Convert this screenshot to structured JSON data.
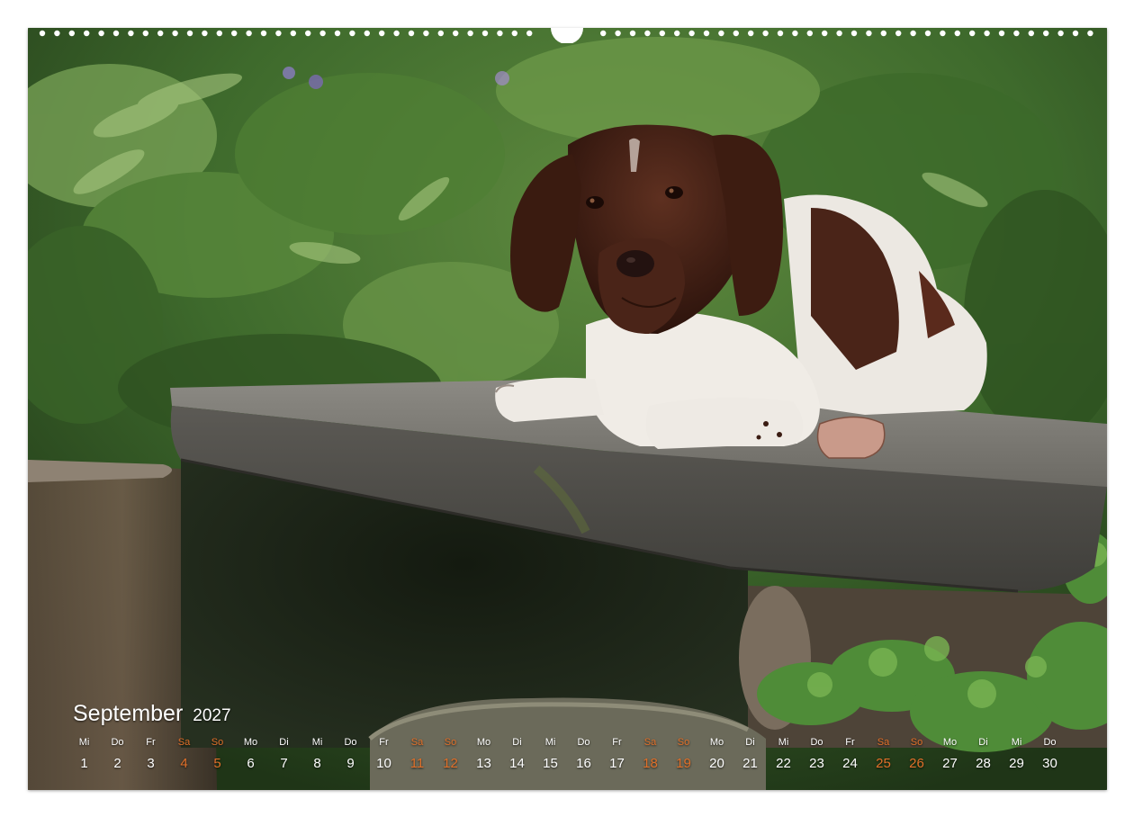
{
  "calendar": {
    "month": "September",
    "year": "2027",
    "accent_color": "#e0702a",
    "days": [
      {
        "wd": "Mi",
        "n": "1",
        "weekend": false
      },
      {
        "wd": "Do",
        "n": "2",
        "weekend": false
      },
      {
        "wd": "Fr",
        "n": "3",
        "weekend": false
      },
      {
        "wd": "Sa",
        "n": "4",
        "weekend": true
      },
      {
        "wd": "So",
        "n": "5",
        "weekend": true
      },
      {
        "wd": "Mo",
        "n": "6",
        "weekend": false
      },
      {
        "wd": "Di",
        "n": "7",
        "weekend": false
      },
      {
        "wd": "Mi",
        "n": "8",
        "weekend": false
      },
      {
        "wd": "Do",
        "n": "9",
        "weekend": false
      },
      {
        "wd": "Fr",
        "n": "10",
        "weekend": false
      },
      {
        "wd": "Sa",
        "n": "11",
        "weekend": true
      },
      {
        "wd": "So",
        "n": "12",
        "weekend": true
      },
      {
        "wd": "Mo",
        "n": "13",
        "weekend": false
      },
      {
        "wd": "Di",
        "n": "14",
        "weekend": false
      },
      {
        "wd": "Mi",
        "n": "15",
        "weekend": false
      },
      {
        "wd": "Do",
        "n": "16",
        "weekend": false
      },
      {
        "wd": "Fr",
        "n": "17",
        "weekend": false
      },
      {
        "wd": "Sa",
        "n": "18",
        "weekend": true
      },
      {
        "wd": "So",
        "n": "19",
        "weekend": true
      },
      {
        "wd": "Mo",
        "n": "20",
        "weekend": false
      },
      {
        "wd": "Di",
        "n": "21",
        "weekend": false
      },
      {
        "wd": "Mi",
        "n": "22",
        "weekend": false
      },
      {
        "wd": "Do",
        "n": "23",
        "weekend": false
      },
      {
        "wd": "Fr",
        "n": "24",
        "weekend": false
      },
      {
        "wd": "Sa",
        "n": "25",
        "weekend": true
      },
      {
        "wd": "So",
        "n": "26",
        "weekend": true
      },
      {
        "wd": "Mo",
        "n": "27",
        "weekend": false
      },
      {
        "wd": "Di",
        "n": "28",
        "weekend": false
      },
      {
        "wd": "Mi",
        "n": "29",
        "weekend": false
      },
      {
        "wd": "Do",
        "n": "30",
        "weekend": false
      }
    ]
  },
  "photo": {
    "subject": "dog-on-wooden-bench",
    "dog_colors": {
      "brown": "#4a2418",
      "white": "#ece8e2"
    },
    "wood_color": "#6f6e6a",
    "foliage_color": "#3f6a2c"
  }
}
